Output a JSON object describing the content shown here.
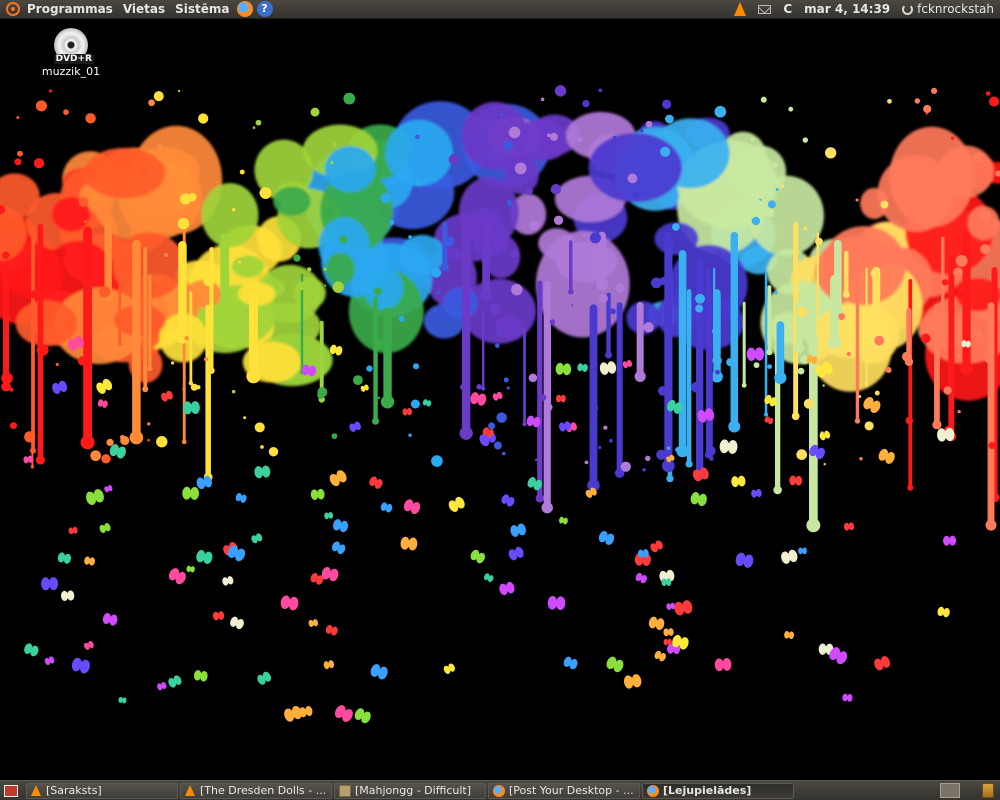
{
  "top_panel": {
    "menus": [
      "Programmas",
      "Vietas",
      "Sistēma"
    ],
    "temperature": "C",
    "clock": "mar  4, 14:39",
    "user": "fcknrockstah"
  },
  "desktop": {
    "icon_label": "muzzik_01",
    "icon_badge": "DVD+R"
  },
  "taskbar": {
    "tasks": [
      {
        "label": "[Saraksts]",
        "icon": "vlc-icon"
      },
      {
        "label": "[The Dresden Dolls - ...",
        "icon": "vlc-icon"
      },
      {
        "label": "[Mahjongg - Difficult]",
        "icon": "mahjongg-icon"
      },
      {
        "label": "[Post Your Desktop - ...",
        "icon": "firefox-icon"
      },
      {
        "label": "[Lejupielādes]",
        "icon": "firefox-icon"
      }
    ]
  },
  "colors": {
    "panel": "#3f3d38",
    "panel_text": "#e8e6e0",
    "ubuntu_orange": "#f47421",
    "wallpaper_bg": "#000000"
  }
}
